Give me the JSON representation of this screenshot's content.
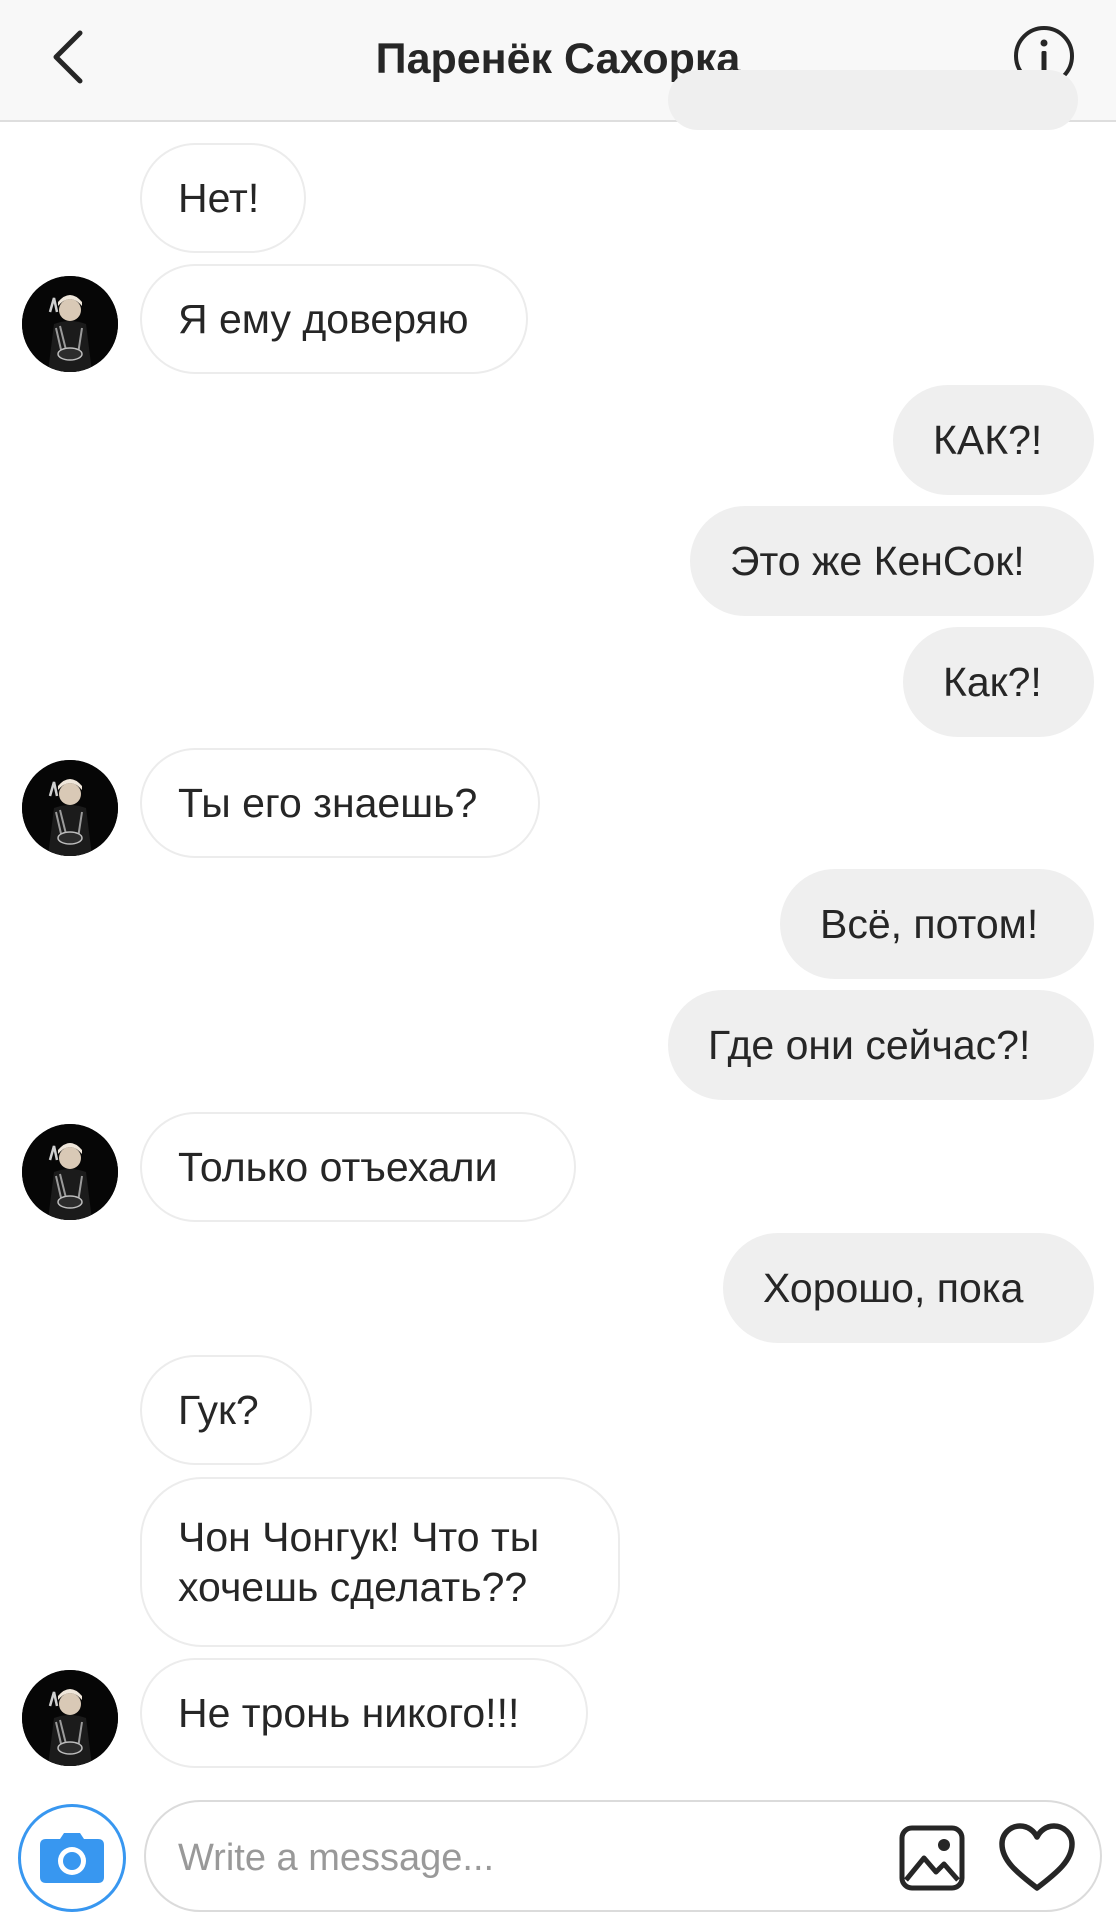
{
  "header": {
    "title": "Паренёк Сахорка",
    "back_icon": "chevron-left-icon",
    "info_icon": "info-icon"
  },
  "messages": [
    {
      "side": "incoming",
      "text": "Нет!"
    },
    {
      "side": "incoming",
      "text": "Я ему доверяю",
      "avatar": true
    },
    {
      "side": "outgoing",
      "text": "КАК?!"
    },
    {
      "side": "outgoing",
      "text": "Это же КенСок!"
    },
    {
      "side": "outgoing",
      "text": "Как?!"
    },
    {
      "side": "incoming",
      "text": "Ты его знаешь?",
      "avatar": true
    },
    {
      "side": "outgoing",
      "text": "Всё, потом!"
    },
    {
      "side": "outgoing",
      "text": "Где они сейчас?!"
    },
    {
      "side": "incoming",
      "text": "Только отъехали",
      "avatar": true
    },
    {
      "side": "outgoing",
      "text": "Хорошо, пока"
    },
    {
      "side": "incoming",
      "text": "Гук?"
    },
    {
      "side": "incoming",
      "text": "Чон Чонгук! Что ты хочешь сделать??"
    },
    {
      "side": "incoming",
      "text": "Не тронь никого!!!",
      "avatar": true
    }
  ],
  "composer": {
    "placeholder": "Write a message...",
    "value": "",
    "camera_icon": "camera-icon",
    "gallery_icon": "image-icon",
    "like_icon": "heart-icon"
  },
  "colors": {
    "accent": "#3897f0",
    "outgoing_bubble": "#efefef",
    "incoming_border": "#ececec",
    "text": "#262626"
  }
}
